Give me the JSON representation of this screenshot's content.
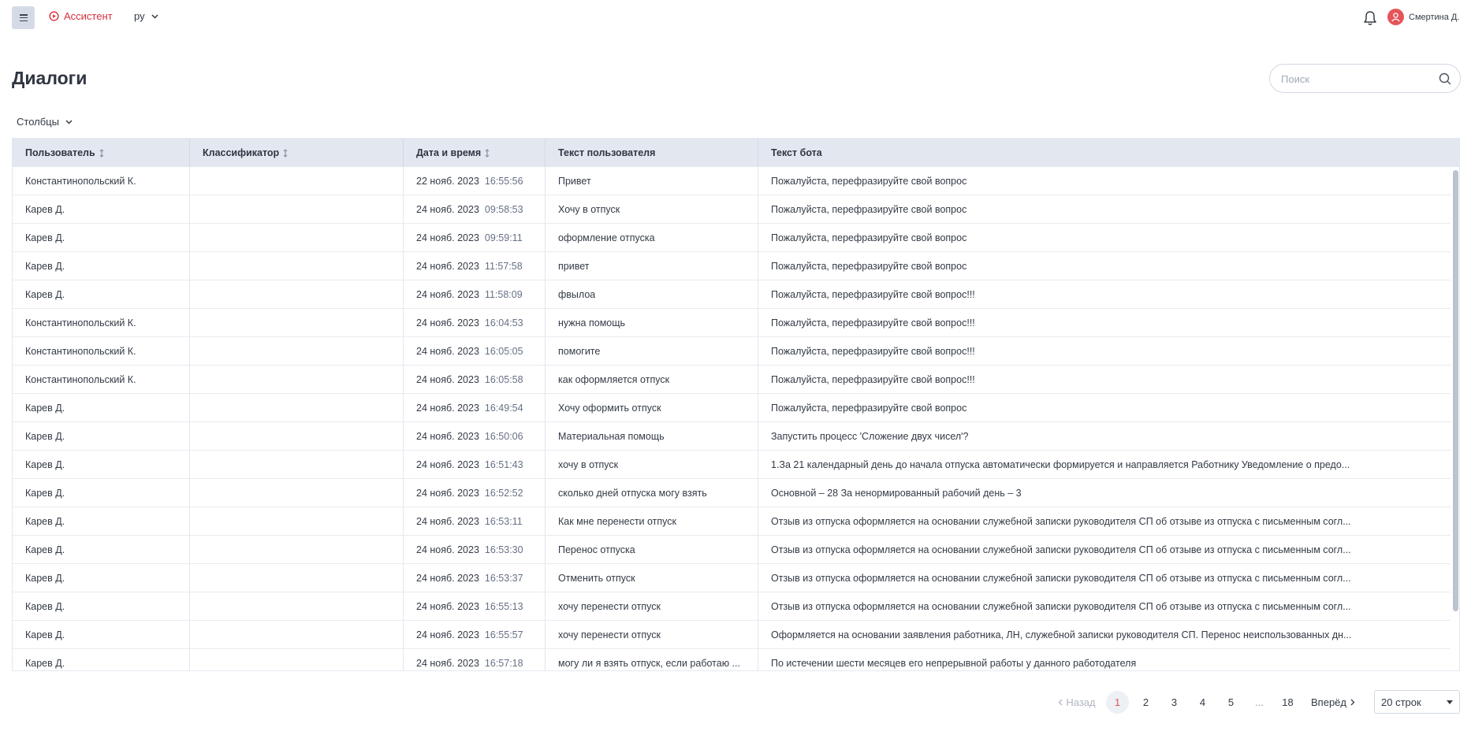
{
  "topbar": {
    "brand": "Ассистент",
    "brand_color": "#d6303b",
    "language": "ру",
    "user_name": "Смертина Д."
  },
  "page": {
    "title": "Диалоги",
    "search_placeholder": "Поиск",
    "columns_button": "Столбцы"
  },
  "table": {
    "headers": [
      "Пользователь",
      "Классификатор",
      "Дата и время",
      "Текст пользователя",
      "Текст бота"
    ],
    "rows": [
      {
        "user": "Константинопольский К.",
        "classifier": "",
        "date": "22 нояб. 2023",
        "time": "16:55:56",
        "user_text": "Привет",
        "bot_text": "Пожалуйста, перефразируйте свой вопрос"
      },
      {
        "user": "Карев Д.",
        "classifier": "",
        "date": "24 нояб. 2023",
        "time": "09:58:53",
        "user_text": "Хочу в отпуск",
        "bot_text": "Пожалуйста, перефразируйте свой вопрос"
      },
      {
        "user": "Карев Д.",
        "classifier": "",
        "date": "24 нояб. 2023",
        "time": "09:59:11",
        "user_text": "оформление отпуска",
        "bot_text": "Пожалуйста, перефразируйте свой вопрос"
      },
      {
        "user": "Карев Д.",
        "classifier": "",
        "date": "24 нояб. 2023",
        "time": "11:57:58",
        "user_text": "привет",
        "bot_text": "Пожалуйста, перефразируйте свой вопрос"
      },
      {
        "user": "Карев Д.",
        "classifier": "",
        "date": "24 нояб. 2023",
        "time": "11:58:09",
        "user_text": "фвылоа",
        "bot_text": "Пожалуйста, перефразируйте свой вопрос!!!"
      },
      {
        "user": "Константинопольский К.",
        "classifier": "",
        "date": "24 нояб. 2023",
        "time": "16:04:53",
        "user_text": "нужна помощь",
        "bot_text": "Пожалуйста, перефразируйте свой вопрос!!!"
      },
      {
        "user": "Константинопольский К.",
        "classifier": "",
        "date": "24 нояб. 2023",
        "time": "16:05:05",
        "user_text": "помогите",
        "bot_text": "Пожалуйста, перефразируйте свой вопрос!!!"
      },
      {
        "user": "Константинопольский К.",
        "classifier": "",
        "date": "24 нояб. 2023",
        "time": "16:05:58",
        "user_text": "как оформляется отпуск",
        "bot_text": "Пожалуйста, перефразируйте свой вопрос!!!"
      },
      {
        "user": "Карев Д.",
        "classifier": "",
        "date": "24 нояб. 2023",
        "time": "16:49:54",
        "user_text": "Хочу оформить отпуск",
        "bot_text": "Пожалуйста, перефразируйте свой вопрос"
      },
      {
        "user": "Карев Д.",
        "classifier": "",
        "date": "24 нояб. 2023",
        "time": "16:50:06",
        "user_text": "Материальная помощь",
        "bot_text": "Запустить процесс 'Сложение двух чисел'?"
      },
      {
        "user": "Карев Д.",
        "classifier": "",
        "date": "24 нояб. 2023",
        "time": "16:51:43",
        "user_text": "хочу в отпуск",
        "bot_text": "1.За 21 календарный день до начала отпуска автоматически формируется и направляется Работнику Уведомление о предо..."
      },
      {
        "user": "Карев Д.",
        "classifier": "",
        "date": "24 нояб. 2023",
        "time": "16:52:52",
        "user_text": "сколько дней отпуска могу взять",
        "bot_text": "Основной – 28 За ненормированный рабочий день – 3"
      },
      {
        "user": "Карев Д.",
        "classifier": "",
        "date": "24 нояб. 2023",
        "time": "16:53:11",
        "user_text": "Как мне перенести отпуск",
        "bot_text": "Отзыв из отпуска оформляется на основании служебной записки руководителя СП об отзыве из отпуска с письменным согл..."
      },
      {
        "user": "Карев Д.",
        "classifier": "",
        "date": "24 нояб. 2023",
        "time": "16:53:30",
        "user_text": "Перенос отпуска",
        "bot_text": "Отзыв из отпуска оформляется на основании служебной записки руководителя СП об отзыве из отпуска с письменным согл..."
      },
      {
        "user": "Карев Д.",
        "classifier": "",
        "date": "24 нояб. 2023",
        "time": "16:53:37",
        "user_text": "Отменить отпуск",
        "bot_text": "Отзыв из отпуска оформляется на основании служебной записки руководителя СП об отзыве из отпуска с письменным согл..."
      },
      {
        "user": "Карев Д.",
        "classifier": "",
        "date": "24 нояб. 2023",
        "time": "16:55:13",
        "user_text": "хочу перенести отпуск",
        "bot_text": "Отзыв из отпуска оформляется на основании служебной записки руководителя СП об отзыве из отпуска с письменным согл..."
      },
      {
        "user": "Карев Д.",
        "classifier": "",
        "date": "24 нояб. 2023",
        "time": "16:55:57",
        "user_text": "хочу перенести отпуск",
        "bot_text": "Оформляется на основании заявления работника, ЛН, служебной записки руководителя СП. Перенос неиспользованных дн..."
      },
      {
        "user": "Карев Д.",
        "classifier": "",
        "date": "24 нояб. 2023",
        "time": "16:57:18",
        "user_text": "могу ли я взять отпуск, если работаю ...",
        "bot_text": "По истечении шести месяцев его непрерывной работы у данного работодателя"
      }
    ]
  },
  "pagination": {
    "prev": "Назад",
    "next": "Вперёд",
    "pages": [
      "1",
      "2",
      "3",
      "4",
      "5",
      "...",
      "18"
    ],
    "current": "1",
    "rows_per_page": "20 строк",
    "active_color": "#e4555a"
  }
}
